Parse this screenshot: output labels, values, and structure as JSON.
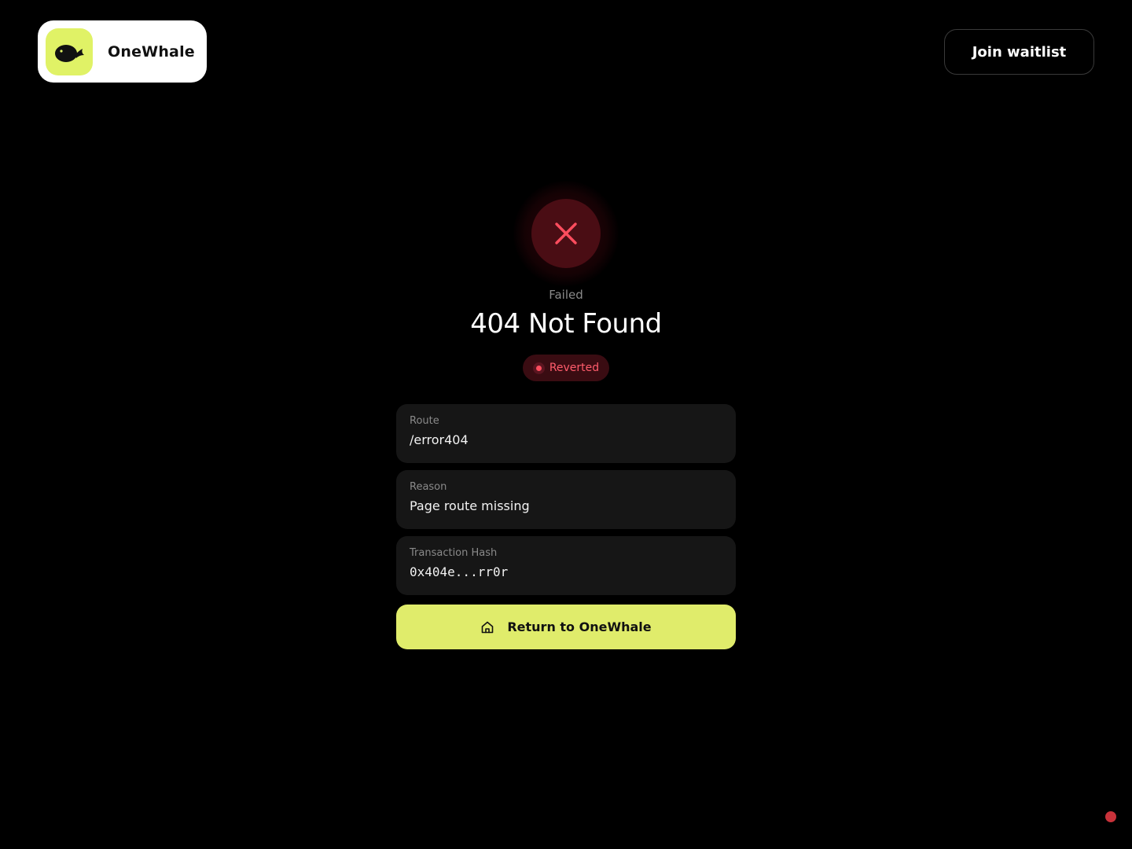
{
  "header": {
    "brand_name": "OneWhale",
    "waitlist_label": "Join waitlist"
  },
  "status": {
    "label": "Failed",
    "title": "404 Not Found",
    "badge": "Reverted"
  },
  "details": [
    {
      "label": "Route",
      "value": "/error404"
    },
    {
      "label": "Reason",
      "value": "Page route missing"
    },
    {
      "label": "Transaction Hash",
      "value": "0x404e...rr0r"
    }
  ],
  "cta": {
    "label": "Return to OneWhale",
    "icon": "home-icon"
  },
  "colors": {
    "accent": "#e0ec6b",
    "logo_bg": "#e0f266",
    "error": "#ff4d5e",
    "error_bg": "#4a0d14"
  }
}
